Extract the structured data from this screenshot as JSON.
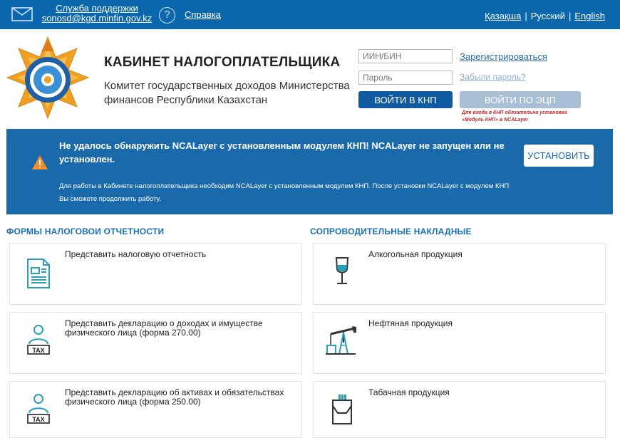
{
  "topbar": {
    "support_line1": "Служба поддержки",
    "support_line2": "sonosd@kgd.minfin.gov.kz",
    "help": "Справка",
    "lang_kk": "Қазақша",
    "lang_ru": "Русский",
    "lang_en": "English",
    "lang_sep": "|"
  },
  "header": {
    "title": "КАБИНЕТ НАЛОГОПЛАТЕЛЬЩИКА",
    "subtitle": "Комитет государственных доходов Министерства финансов Республики Казахстан"
  },
  "login": {
    "iin_placeholder": "ИИН/БИН",
    "password_placeholder": "Пароль",
    "register": "Зарегистрироваться",
    "forgot": "Забыли пароль?",
    "login_knp": "ВОЙТИ В КНП",
    "login_ecp": "ВОЙТИ ПО ЭЦП",
    "ecp_note": "Для входа в КНП обязательна установка «Модуль КНП» в NCALayer"
  },
  "alert": {
    "title": "Не удалось обнаружить NCALayer с установленным модулем КНП! NCALayer не запущен или не установлен.",
    "description": "Для работы в Кабинете налогоплательщика необходим NCALayer с установленным модулем КНП. После установки NCALayer с модулем КНП Вы сможете продолжить работу.",
    "install": "УСТАНОВИТЬ"
  },
  "sections": {
    "tax_forms_title": "ФОРМЫ НАЛОГОВОИ ОТЧЕТНОСТИ",
    "waybills_title": "СОПРОВОДИТЕЛЬНЫЕ НАКЛАДНЫЕ",
    "tax_forms": [
      {
        "label": "Представить налоговую отчетность",
        "icon": "document-icon"
      },
      {
        "label": "Представить декларацию о доходах и имуществе физического лица (форма 270.00)",
        "icon": "person-tax-icon"
      },
      {
        "label": "Представить декларацию об активах и обязательствах физического лица (форма 250.00)",
        "icon": "person-tax-icon"
      }
    ],
    "waybills": [
      {
        "label": "Алкогольная продукция",
        "icon": "wine-glass-icon"
      },
      {
        "label": "Нефтяная продукция",
        "icon": "oil-pump-icon"
      },
      {
        "label": "Табачная продукция",
        "icon": "cigarette-pack-icon"
      }
    ]
  },
  "colors": {
    "brand_blue": "#0a66ad",
    "alert_blue": "#1a6aab",
    "section_title": "#1a70b5",
    "icon_teal": "#2aa0b8",
    "warning_orange": "#f08c2a"
  }
}
